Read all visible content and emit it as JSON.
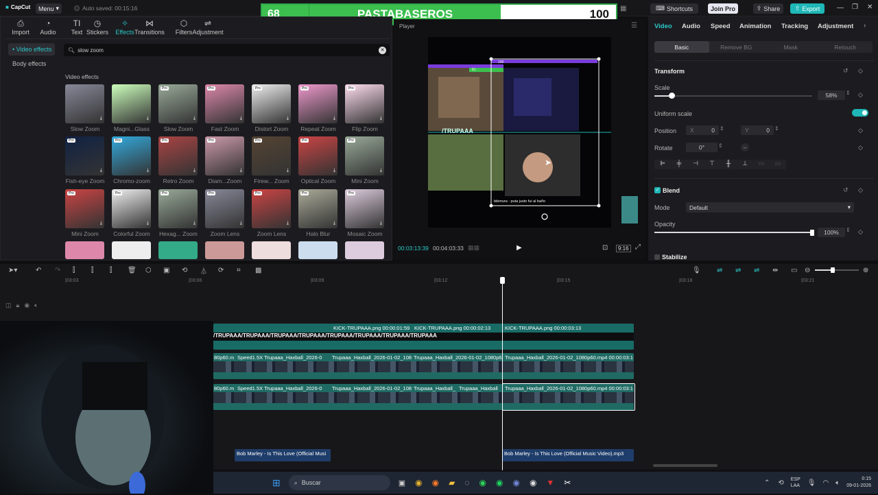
{
  "app": {
    "logo": "CapCut",
    "menu_label": "Menu",
    "autosave": "Auto saved: 00:15:16"
  },
  "scoreboard": {
    "left_score": "68",
    "team": "PASTABASEROS",
    "right_score": "100"
  },
  "topright": {
    "shortcuts": "Shortcuts",
    "join_pro": "Join Pro",
    "share": "Share",
    "export": "Export"
  },
  "toolbar": [
    {
      "label": "Import",
      "icon": "import-icon"
    },
    {
      "label": "Audio",
      "icon": "audio-icon"
    },
    {
      "label": "Text",
      "icon": "text-icon"
    },
    {
      "label": "Stickers",
      "icon": "stickers-icon"
    },
    {
      "label": "Effects",
      "icon": "effects-icon"
    },
    {
      "label": "Transitions",
      "icon": "transitions-icon"
    },
    {
      "label": "Filters",
      "icon": "filters-icon"
    },
    {
      "label": "Adjustment",
      "icon": "adjustment-icon"
    }
  ],
  "effects_sidebar": [
    "• Video effects",
    "Body effects"
  ],
  "search": {
    "value": "slow zoom"
  },
  "section_title": "Video effects",
  "effects": [
    "Slow Zoom",
    "Magni...Glass",
    "Slow Zoom",
    "Fast Zoom",
    "Distort Zoom",
    "Repeat Zoom",
    "Flip Zoom",
    "Fish-eye Zoom",
    "Chromo-zoom",
    "Retro Zoom",
    "Diam...Zoom",
    "Firew... Zoom",
    "Optical Zoom",
    "Mini Zoom",
    "Mini Zoom",
    "Colorful Zoom",
    "Hexag... Zoom",
    "Zoom Lens",
    "Zoom Lens",
    "Halo Blur",
    "Mosaic Zoom"
  ],
  "player": {
    "title": "Player",
    "current_time": "00:03:13:39",
    "total_time": "00:04:03:33",
    "ratio": "9:16",
    "caption": "bbimura : puta justo fui al baño",
    "overlay_text": "/TRUPAAA",
    "mini_score": "100",
    "mini_label": "61"
  },
  "right_tabs": [
    "Video",
    "Audio",
    "Speed",
    "Animation",
    "Tracking",
    "Adjustment"
  ],
  "sub_tabs": [
    "Basic",
    "Remove BG",
    "Mask",
    "Retouch"
  ],
  "transform": {
    "title": "Transform",
    "scale_label": "Scale",
    "scale_value": "58%",
    "scale_fraction": 0.11,
    "uniform_label": "Uniform scale",
    "position_label": "Position",
    "x_label": "X",
    "x_value": "0",
    "y_label": "Y",
    "y_value": "0",
    "rotate_label": "Rotate",
    "rotate_value": "0°"
  },
  "blend": {
    "title": "Blend",
    "mode_label": "Mode",
    "mode_value": "Default",
    "opacity_label": "Opacity",
    "opacity_value": "100%",
    "opacity_fraction": 1.0
  },
  "stabilize_label": "Stabilize",
  "ruler_ticks": [
    "|03:03",
    "|03:06",
    "|03:09",
    "|03:12",
    "|03:15",
    "|03:18",
    "|03:21"
  ],
  "clips": {
    "kick1": "KICK-TRUPAAA.png  00:00:01:59",
    "kick2": "KICK-TRUPAAA.png  00:00:02:13",
    "kick3": "KICK-TRUPAAA.png  00:00:03:13",
    "trupaa_strip": "/TRUPAAA/TRUPAAA/TRUPAAA/TRUPAAA/TRUPAAA/TRUPAAA/TRUPAAA/TRUPAAA",
    "v1a": "80p60.m",
    "v1b": "Speed1.5X  Trupaaa_Haxball_2026-0",
    "v1c": "Trupaaa_Haxball_2026-01-02_108",
    "v1d": "Trupaaa_Haxball_2026-01-02_1080p6",
    "v1e": "Trupaaa_Haxball_2026-01-02_1080p60.mp4  00:00:03:1",
    "v2a": "80p60.m",
    "v2b": "Speed1.5X  Trupaaa_Haxball_2026-0",
    "v2c": "Trupaaa_Haxball_2026-01-02_108",
    "v2d": "Trupaaa_Haxball_",
    "v2e": "Trupaaa_Haxball",
    "v2f": "Trupaaa_Haxball_2026-01-02_1080p60.mp4  00:00:03:1",
    "audio1": "Bob Marley - Is This Love (Official Musi",
    "audio2": "Bob Marley - Is This Love (Official Music Video).mp3"
  },
  "taskbar": {
    "search": "Buscar",
    "lang1": "ESP",
    "lang2": "LAA",
    "time": "0:15",
    "date": "09-01-2026"
  }
}
